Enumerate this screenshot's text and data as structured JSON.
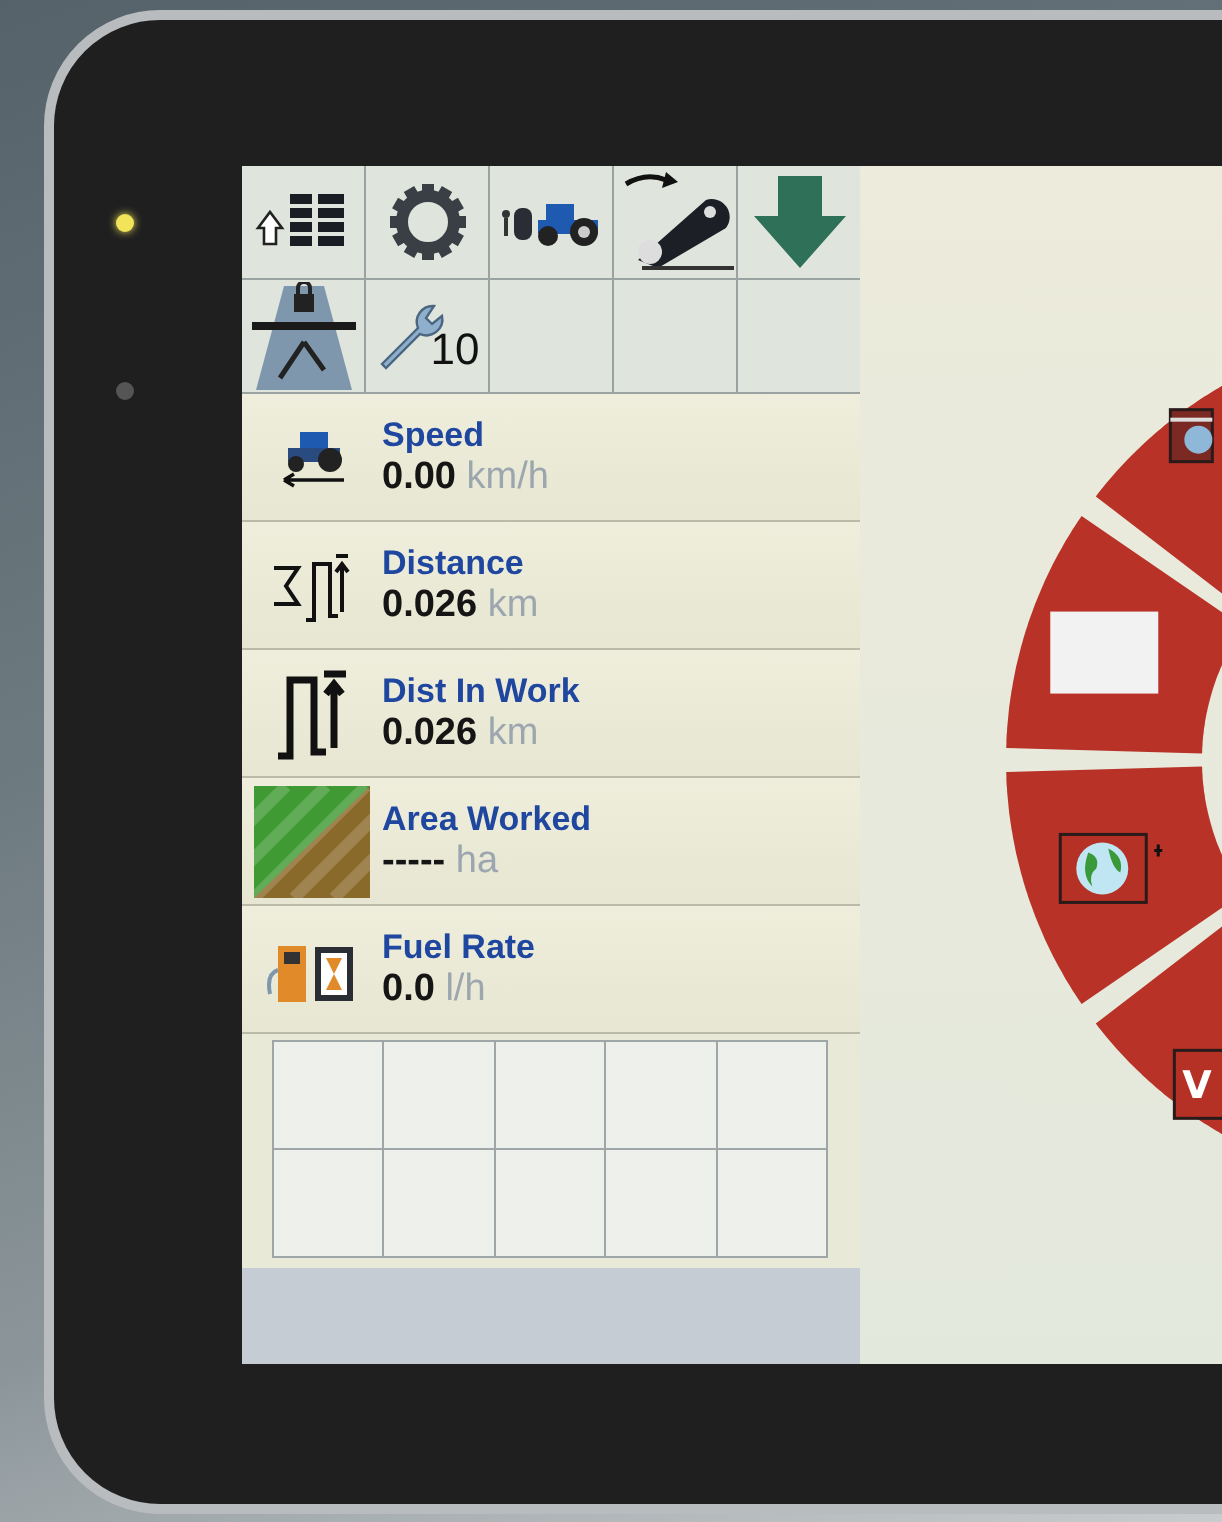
{
  "leds": [
    {
      "on": true
    },
    {
      "on": false
    }
  ],
  "toolbar": [
    {
      "kind": "list-up"
    },
    {
      "kind": "gear"
    },
    {
      "kind": "tractor"
    },
    {
      "kind": "link"
    },
    {
      "kind": "down"
    },
    {
      "kind": "road"
    },
    {
      "kind": "wrench",
      "badge": "10"
    },
    {
      "kind": "empty"
    },
    {
      "kind": "empty"
    },
    {
      "kind": "empty"
    }
  ],
  "metrics": [
    {
      "kind": "speed",
      "label": "Speed",
      "value": "0.00",
      "unit": "km/h"
    },
    {
      "kind": "distance",
      "label": "Distance",
      "value": "0.026",
      "unit": "km"
    },
    {
      "kind": "work",
      "label": "Dist In Work",
      "value": "0.026",
      "unit": "km"
    },
    {
      "kind": "area",
      "label": "Area Worked",
      "value": "-----",
      "unit": "ha"
    },
    {
      "kind": "fuel",
      "label": "Fuel Rate",
      "value": "0.0",
      "unit": "l/h"
    }
  ],
  "ring_segments": [
    {
      "kind": "cut"
    },
    {
      "kind": "blank"
    },
    {
      "kind": "globe"
    },
    {
      "kind": "letter",
      "text": "V"
    }
  ]
}
